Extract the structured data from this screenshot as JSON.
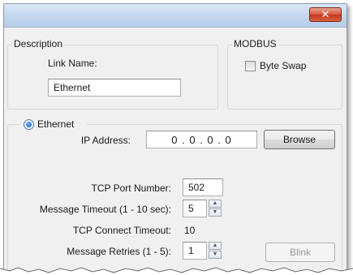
{
  "titlebar": {
    "close_glyph": "✕"
  },
  "description": {
    "legend": "Description",
    "link_name_label": "Link Name:",
    "link_name_value": "Ethernet"
  },
  "modbus": {
    "legend": "MODBUS",
    "byte_swap_label": "Byte Swap",
    "byte_swap_checked": false
  },
  "ethernet": {
    "radio_label": "Ethernet",
    "radio_selected": true,
    "ip_address_label": "IP Address:",
    "ip_address_value": "0 . 0 . 0 . 0",
    "browse_label": "Browse",
    "tcp_port_label": "TCP Port Number:",
    "tcp_port_value": "502",
    "message_timeout_label": "Message Timeout (1 - 10 sec):",
    "message_timeout_value": "5",
    "tcp_connect_timeout_label": "TCP Connect Timeout:",
    "tcp_connect_timeout_value": "10",
    "message_retries_label": "Message Retries (1 - 5):",
    "message_retries_value": "1",
    "blink_label": "Blink"
  }
}
